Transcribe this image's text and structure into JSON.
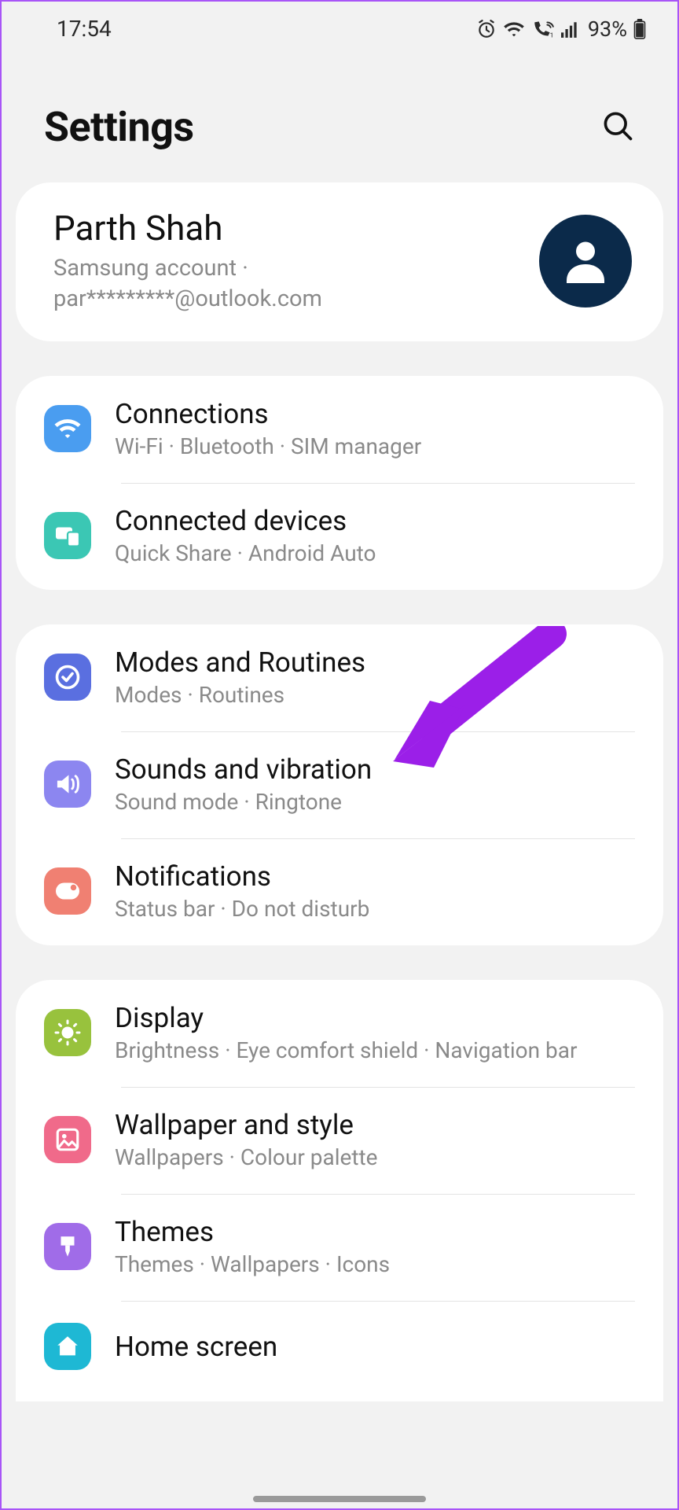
{
  "status": {
    "time": "17:54",
    "battery": "93%"
  },
  "header": {
    "title": "Settings"
  },
  "account": {
    "name": "Parth Shah",
    "subtitle": "Samsung account  ·  par*********@outlook.com"
  },
  "groups": [
    {
      "items": [
        {
          "id": "connections",
          "title": "Connections",
          "sub": "Wi-Fi  ·  Bluetooth  ·  SIM manager",
          "color": "#4a9df0"
        },
        {
          "id": "connected-devices",
          "title": "Connected devices",
          "sub": "Quick Share  ·  Android Auto",
          "color": "#3bc7b4"
        }
      ]
    },
    {
      "items": [
        {
          "id": "modes-routines",
          "title": "Modes and Routines",
          "sub": "Modes  ·  Routines",
          "color": "#5a6fe0"
        },
        {
          "id": "sounds-vibration",
          "title": "Sounds and vibration",
          "sub": "Sound mode  ·  Ringtone",
          "color": "#8c86f0"
        },
        {
          "id": "notifications",
          "title": "Notifications",
          "sub": "Status bar  ·  Do not disturb",
          "color": "#f08072"
        }
      ]
    },
    {
      "items": [
        {
          "id": "display",
          "title": "Display",
          "sub": "Brightness  ·  Eye comfort shield  ·  Navigation bar",
          "color": "#98c23d"
        },
        {
          "id": "wallpaper-style",
          "title": "Wallpaper and style",
          "sub": "Wallpapers  ·  Colour palette",
          "color": "#f06a8a"
        },
        {
          "id": "themes",
          "title": "Themes",
          "sub": "Themes  ·  Wallpapers  ·  Icons",
          "color": "#a06ce8"
        },
        {
          "id": "home-screen",
          "title": "Home screen",
          "sub": "",
          "color": "#1eb8d4"
        }
      ]
    }
  ]
}
